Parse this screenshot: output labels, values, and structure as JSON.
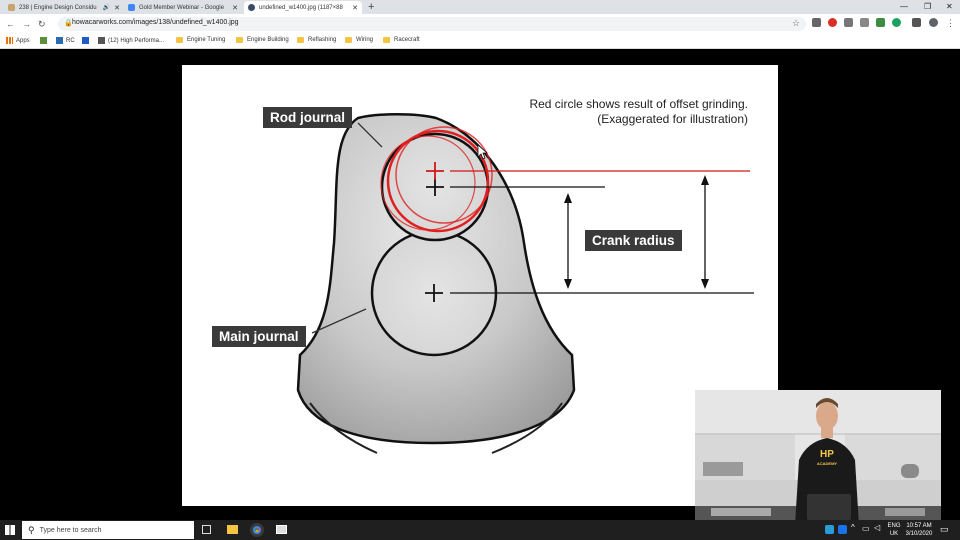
{
  "browser": {
    "tabs": [
      {
        "title": "238 | Engine Design Considu",
        "favicon_color": "#c9a36b"
      },
      {
        "title": "Gold Member Webinar - Google",
        "favicon_color": "#4285f4"
      },
      {
        "title": "undefined_w1400.jpg (1187×88",
        "favicon_color": "#3a4a6b"
      }
    ],
    "new_tab": "+",
    "window_controls": {
      "minimize": "—",
      "restore": "❐",
      "close": "✕"
    },
    "nav": {
      "back": "←",
      "forward": "→",
      "reload": "↻"
    },
    "address": "howacarworks.com/images/138/undefined_w1400.jpg",
    "star": "☆",
    "bookmarks": [
      {
        "label": "Apps",
        "type": "apps"
      },
      {
        "label": "",
        "type": "icon",
        "color": "#5a8f3c"
      },
      {
        "label": "RC",
        "type": "icon",
        "color": "#2b6cb0"
      },
      {
        "label": "",
        "type": "icon",
        "color": "#1e5bc6"
      },
      {
        "label": "(12) High Performa...",
        "type": "icon",
        "color": "#555555"
      },
      {
        "label": "Engine Tuning",
        "type": "folder"
      },
      {
        "label": "Engine Building",
        "type": "folder"
      },
      {
        "label": "Reflashing",
        "type": "folder"
      },
      {
        "label": "Wiring",
        "type": "folder"
      },
      {
        "label": "Racecraft",
        "type": "folder"
      }
    ]
  },
  "slide": {
    "caption_line1": "Red circle shows result of offset grinding.",
    "caption_line2": "(Exaggerated for illustration)",
    "label_rod": "Rod journal",
    "label_main": "Main journal",
    "label_radius": "Crank radius"
  },
  "webcam": {
    "shirt_text_top": "HP",
    "shirt_text_bottom": "ACADEMY"
  },
  "taskbar": {
    "search_placeholder": "Type here to search",
    "lang_top": "ENG",
    "lang_bottom": "UK",
    "time": "10:57 AM",
    "date": "3/10/2020"
  }
}
